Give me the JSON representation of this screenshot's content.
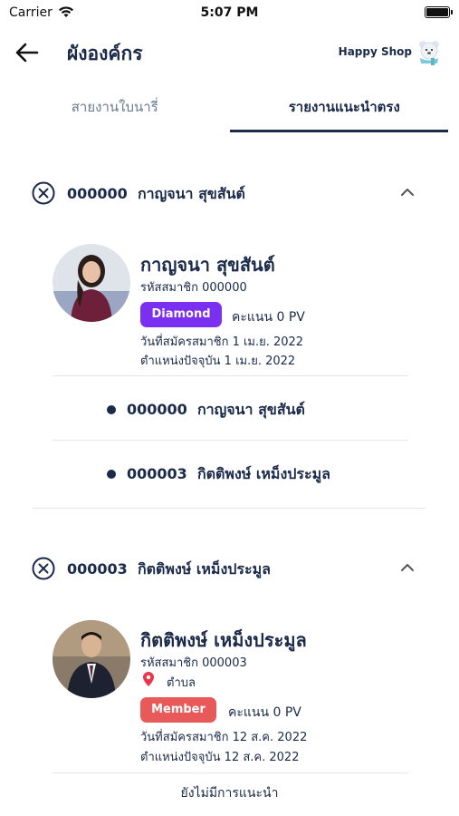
{
  "status_bar": {
    "carrier": "Carrier",
    "time": "5:07 PM"
  },
  "header": {
    "title": "ผังองค์กร",
    "brand": "Happy Shop"
  },
  "tabs": [
    {
      "label": "สายงานใบนารี่",
      "active": false
    },
    {
      "label": "รายงานแนะนำตรง",
      "active": true
    }
  ],
  "colors": {
    "primary": "#1b2a4a",
    "diamond": "#7b2ff0",
    "member": "#e85a5a",
    "pin": "#e8364a"
  },
  "sections": [
    {
      "code": "000000",
      "name": "กาญจนา สุขสันต์",
      "profile": {
        "name": "กาญจนา สุขสันต์",
        "member_code": "รหัสสมาชิก 000000",
        "badge": "Diamond",
        "score": "คะแนน 0 PV",
        "joined": "วันที่สมัครสมาชิก 1 เม.ย. 2022",
        "position": "ตำแหน่งปัจจุบัน 1 เม.ย. 2022"
      },
      "referrals": [
        {
          "code": "000000",
          "name": "กาญจนา สุขสันต์"
        },
        {
          "code": "000003",
          "name": "กิตติพงษ์ เหม็งประมูล"
        }
      ]
    },
    {
      "code": "000003",
      "name": "กิตติพงษ์ เหม็งประมูล",
      "profile": {
        "name": "กิตติพงษ์ เหม็งประมูล",
        "member_code": "รหัสสมาชิก 000003",
        "location": "ตำบล",
        "badge": "Member",
        "score": "คะแนน 0 PV",
        "joined": "วันที่สมัครสมาชิก 12 ส.ค. 2022",
        "position": "ตำแหน่งปัจจุบัน 12 ส.ค. 2022"
      },
      "empty_note": "ยังไม่มีการแนะนำ"
    }
  ]
}
